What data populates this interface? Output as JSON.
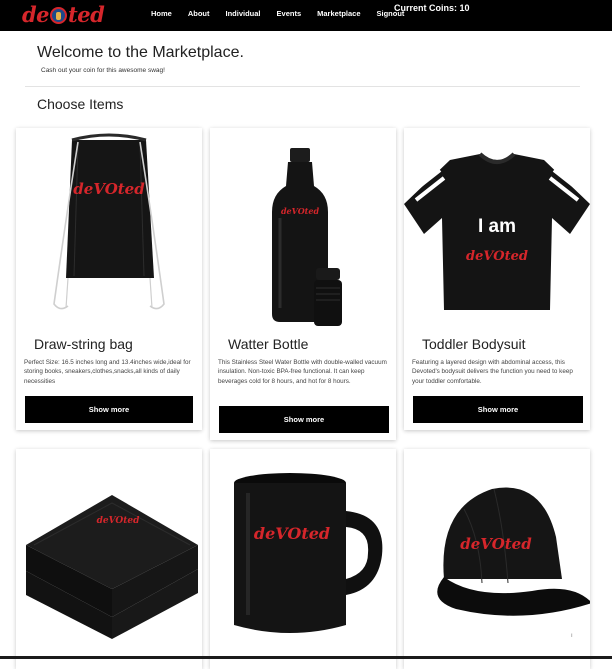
{
  "nav": {
    "logo": "deVOted",
    "links": [
      "Home",
      "About",
      "Individual",
      "Events",
      "Marketplace",
      "Signout"
    ],
    "coins": "Current Coins: 10"
  },
  "header": {
    "title": "Welcome to the Marketplace.",
    "subtitle": "Cash out your coin for this awesome swag!"
  },
  "section": {
    "title": "Choose Items"
  },
  "items": [
    {
      "title": "Draw-string bag",
      "description": "Perfect Size: 16.5 inches long and 13.4inches wide,ideal for storing books, sneakers,clothes,snacks,all kinds of daily necessities",
      "button": "Show more"
    },
    {
      "title": "Watter Bottle",
      "description": "This Stainless Steel Water Bottle with double-walled vacuum insulation. Non-toxic BPA-free functional. It can keep beverages cold for 8 hours, and hot for 8 hours.",
      "button": "Show more"
    },
    {
      "title": "Toddler Bodysuit",
      "description": "Featuring a layered design with abdominal access, this Devoted's bodysuit delivers the function you need to keep your toddler comfortable.",
      "button": "Show more",
      "image_text": "I am"
    }
  ],
  "extra_items": [
    {
      "name": "towel"
    },
    {
      "name": "mug"
    },
    {
      "name": "cap"
    }
  ],
  "brand_mark": "deVOted",
  "colors": {
    "brand_red": "#d6262b",
    "navbar": "#000000",
    "button": "#000000"
  }
}
